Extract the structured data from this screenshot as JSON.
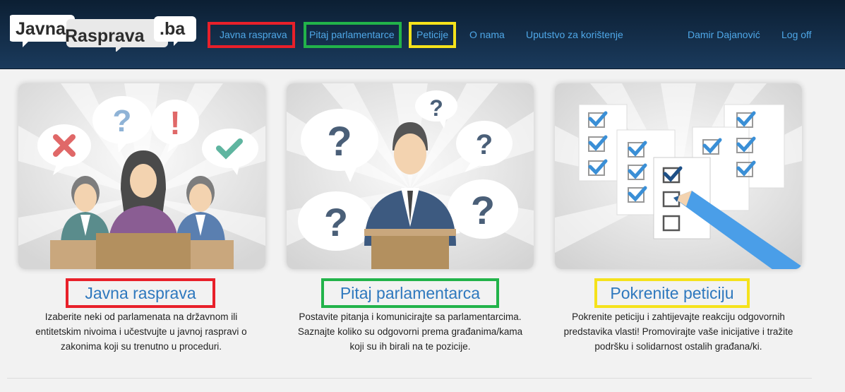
{
  "logo": {
    "word1": "Javna",
    "word2": "Rasprava",
    "word3": ".ba"
  },
  "nav": {
    "links": [
      {
        "label": "Javna rasprava"
      },
      {
        "label": "Pitaj parlamentarce"
      },
      {
        "label": "Peticije"
      },
      {
        "label": "O nama"
      },
      {
        "label": "Uputstvo za korištenje"
      }
    ],
    "user": "Damir Dajanović",
    "logout": "Log off"
  },
  "cards": [
    {
      "title": "Javna rasprava",
      "description": "Izaberite neki od parlamenata na državnom ili entitetskim nivoima i učestvujte u javnoj raspravi o zakonima koji su trenutno u proceduri."
    },
    {
      "title": "Pitaj parlamentarca",
      "description": "Postavite pitanja i komunicirajte sa parlamentarcima. Saznajte koliko su odgovorni prema građanima/kama koji su ih birali na te pozicije."
    },
    {
      "title": "Pokrenite peticiju",
      "description": "Pokrenite peticiju i zahtijevajte reakciju odgovornih predstavika vlasti! Promovirajte vaše inicijative i tražite podršku i solidarnost ostalih građana/ki."
    }
  ],
  "illustration_symbols": {
    "question": "?",
    "exclamation": "!"
  },
  "colors": {
    "navbar": "#12304f",
    "nav_link": "#4fa8e8",
    "title": "#2e78be",
    "highlight_red": "#e8202a",
    "highlight_green": "#22b34a",
    "highlight_yellow": "#f5e21b"
  }
}
